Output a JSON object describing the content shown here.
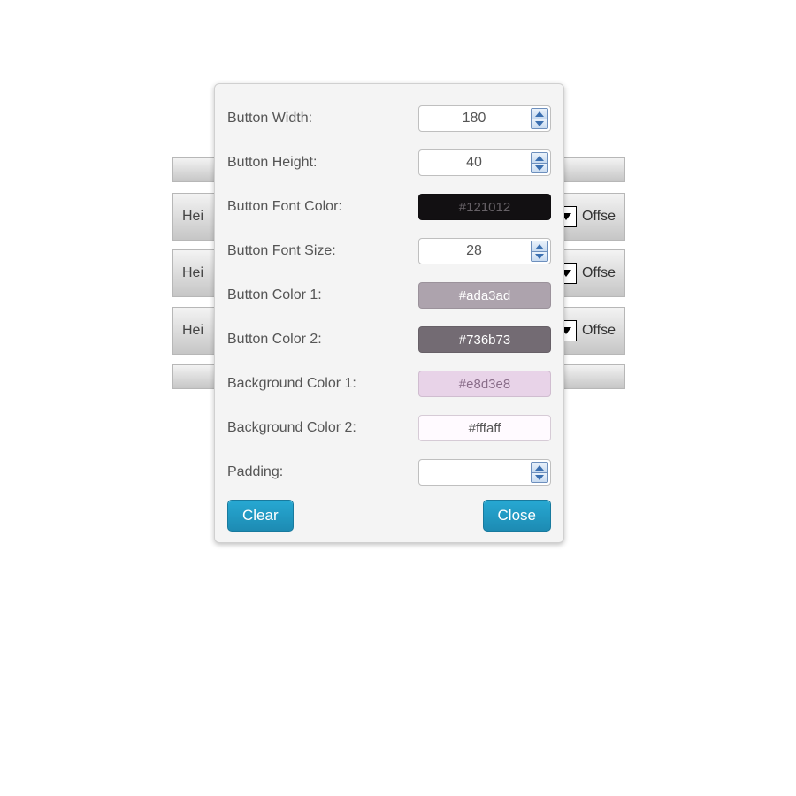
{
  "background_rows": [
    {
      "label": "Hei",
      "offset": "Offse"
    },
    {
      "label": "Hei",
      "offset": "Offse"
    },
    {
      "label": "Hei",
      "offset": "Offse"
    }
  ],
  "fields": {
    "button_width": {
      "label": "Button Width:",
      "value": "180"
    },
    "button_height": {
      "label": "Button Height:",
      "value": "40"
    },
    "button_font_color": {
      "label": "Button Font Color:",
      "value": "#121012"
    },
    "button_font_size": {
      "label": "Button Font Size:",
      "value": "28"
    },
    "button_color_1": {
      "label": "Button Color 1:",
      "value": "#ada3ad"
    },
    "button_color_2": {
      "label": "Button Color 2:",
      "value": "#736b73"
    },
    "background_color_1": {
      "label": "Background Color 1:",
      "value": "#e8d3e8"
    },
    "background_color_2": {
      "label": "Background Color 2:",
      "value": "#fffaff"
    },
    "padding": {
      "label": "Padding:",
      "value": ""
    }
  },
  "buttons": {
    "clear": "Clear",
    "close": "Close"
  }
}
